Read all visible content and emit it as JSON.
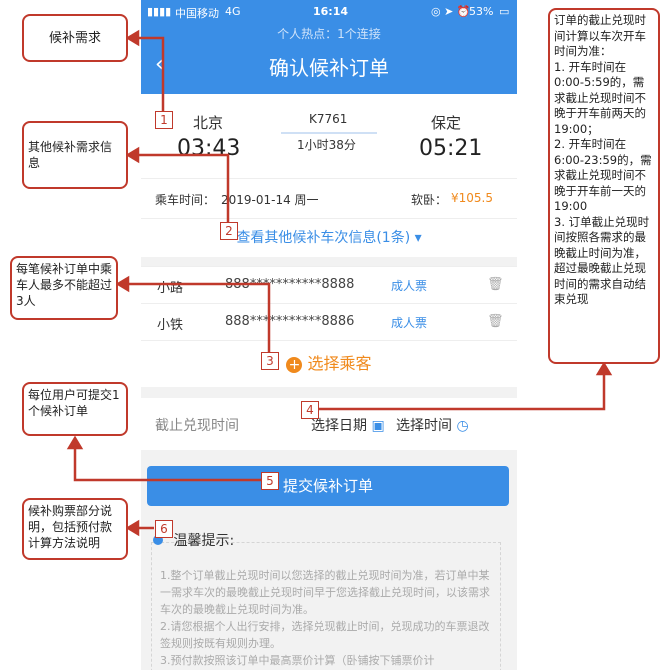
{
  "status": {
    "carrier": "中国移动",
    "network": "4G",
    "time": "16:14",
    "battery": "53%"
  },
  "nav": {
    "hotspot": "个人热点：1个连接",
    "back_glyph": "‹",
    "title": "确认候补订单"
  },
  "trip": {
    "from": "北京",
    "depart": "03:43",
    "train": "K7761",
    "duration": "1小时38分",
    "to": "保定",
    "arrive": "05:21"
  },
  "info": {
    "date_label": "乘车时间：",
    "date": "2019-01-14 周一",
    "seat_label": "软卧：",
    "price": "¥105.5"
  },
  "more_link": "查看其他候补车次信息(1条)",
  "passengers": [
    {
      "name": "小路",
      "id": "888***********8888",
      "type": "成人票"
    },
    {
      "name": "小铁",
      "id": "888***********8886",
      "type": "成人票"
    }
  ],
  "add_passenger": "选择乘客",
  "deadline": {
    "label": "截止兑现时间",
    "date": "选择日期",
    "time": "选择时间"
  },
  "submit": "提交候补订单",
  "tips": {
    "title": "温馨提示:",
    "lines": [
      "1.整个订单截止兑现时间以您选择的截止兑现时间为准，若订单中某一需求车次的最晚截止兑现时间早于您选择截止兑现时间，以该需求车次的最晚截止兑现时间为准。",
      "2.请您根据个人出行安排，选择兑现截止时间，兑现成功的车票退改签规则按既有规则办理。",
      "3.预付款按照该订单中最高票价计算（卧铺按下铺票价计"
    ]
  },
  "callouts": {
    "c1": "候补需求",
    "c2": "其他候补需求信息",
    "c3": "每笔候补订单中乘车人最多不能超过3人",
    "c4": "每位用户可提交1个候补订单",
    "c5": "候补购票部分说明，包括预付款计算方法说明",
    "right": "订单的截止兑现时间计算以车次开车时间为准：\n1. 开车时间在0:00-5:59的，需求截止兑现时间不晚于开车前两天的19:00；\n2. 开车时间在6:00-23:59的，需求截止兑现时间不晚于开车前一天的19:00\n3. 订单截止兑现时间按照各需求的最晚截止时间为准，超过最晚截止兑现时间的需求自动结束兑现"
  },
  "numbers": [
    "1",
    "2",
    "3",
    "4",
    "5",
    "6"
  ],
  "colors": {
    "primary": "#3a8ee6",
    "accent": "#f08a1d",
    "annotation": "#c0392b"
  }
}
